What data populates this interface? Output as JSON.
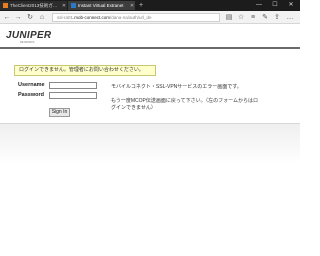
{
  "browser": {
    "tabs": [
      {
        "label": "TheClient2013技術ガイド_擦",
        "active": false,
        "favicon_color": "#e67e22"
      },
      {
        "label": "Instant Virtual Extranet",
        "active": true,
        "favicon_color": "#2b78c5"
      }
    ],
    "new_tab_label": "+",
    "window_controls": {
      "minimize": "—",
      "maximize": "☐",
      "close": "✕"
    },
    "nav": {
      "back": "←",
      "forward": "→",
      "refresh": "↻",
      "home": "⌂"
    },
    "address": {
      "prefix": "ssl-ra01",
      "host": ".mob-connect.com",
      "path": "/dana-na/auth/url_de"
    },
    "actions": {
      "reading_view": "▤",
      "favorite": "☆",
      "hub": "≡",
      "notes": "✎",
      "share": "⇪",
      "more": "…"
    }
  },
  "brand": {
    "logo": "JUNIPER",
    "tagline": "NETWORKS"
  },
  "login": {
    "alert": "ログインできません。管理者にお問い合わせください。",
    "username_label": "Username",
    "password_label": "Password",
    "username_value": "",
    "password_value": "",
    "signin_label": "Sign In"
  },
  "info": {
    "line1": "モバイルコネクト・SSL-VPNサービスのエラー画面です。",
    "line2": "もう一度MCOP伝送画面に戻って下さい。（左のフォームからはロ",
    "line3": "グインできません）"
  },
  "colors": {
    "alert_bg": "#ffffcc",
    "titlebar_bg": "#1c1c1c",
    "brandline": "#6a6a6a"
  }
}
